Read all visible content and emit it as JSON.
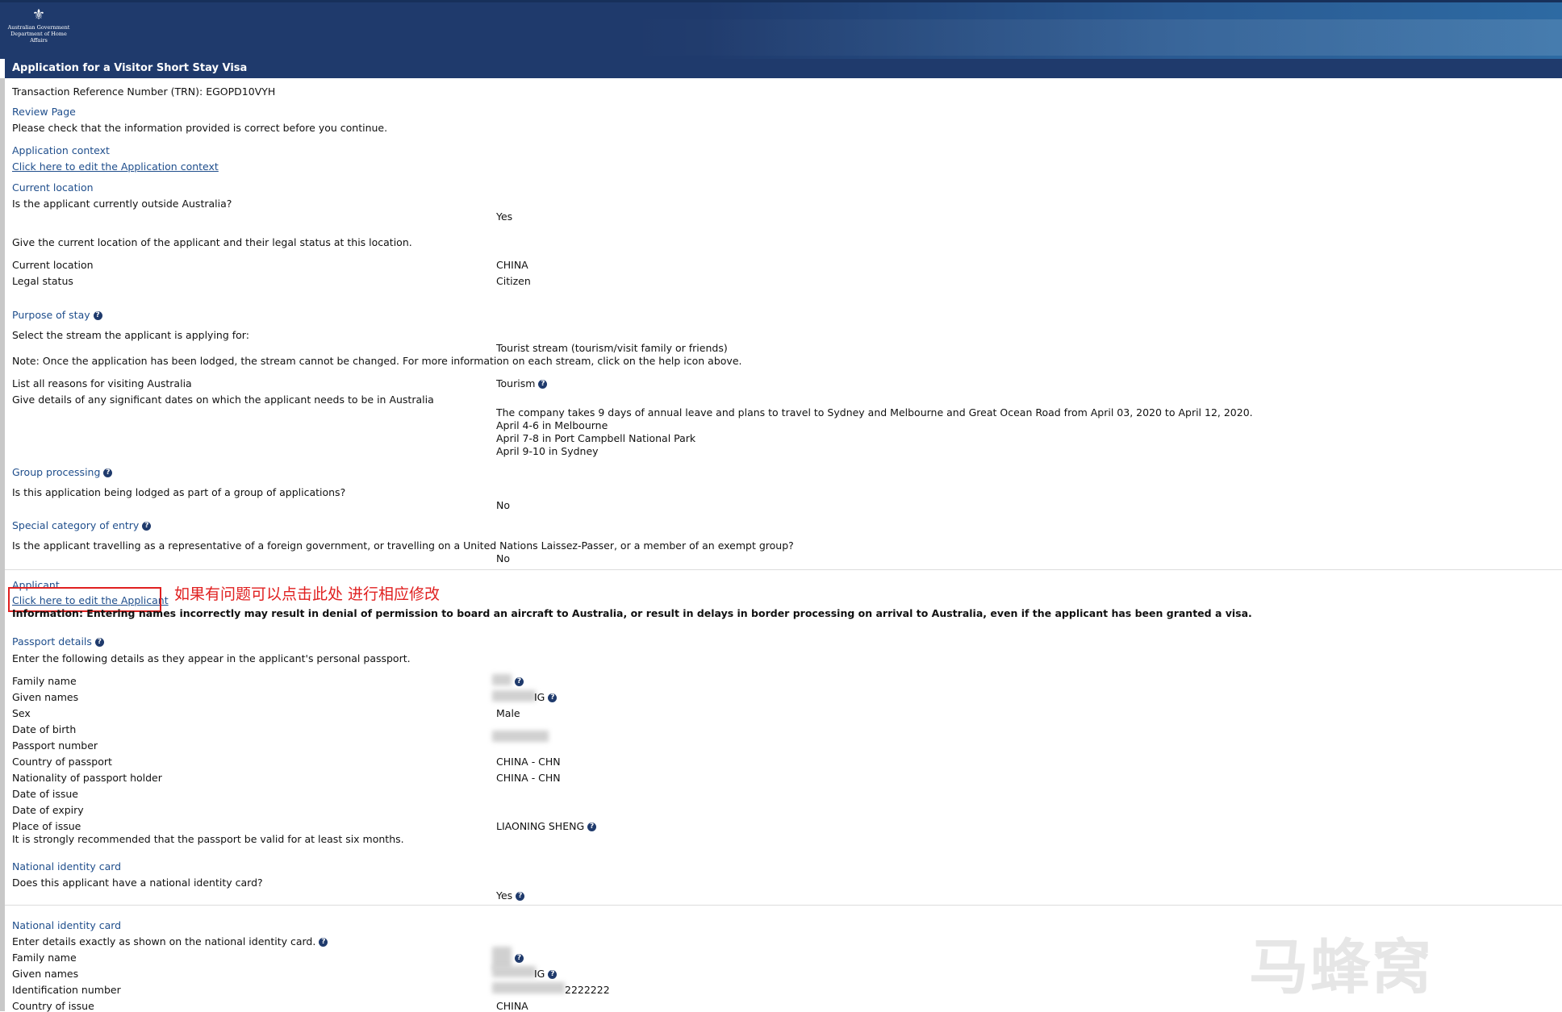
{
  "header": {
    "gov_line1": "Australian Government",
    "gov_line2": "Department of Home Affairs",
    "title": "Application for a Visitor Short Stay Visa"
  },
  "trn": "Transaction Reference Number (TRN): EGOPD10VYH",
  "review": {
    "title": "Review Page",
    "note": "Please check that the information provided is correct before you continue."
  },
  "app_context": {
    "title": "Application context",
    "edit_link": "Click here to edit the Application context"
  },
  "current_location": {
    "title": "Current location",
    "q_outside": "Is the applicant currently outside Australia?",
    "a_outside": "Yes",
    "give_location": "Give the current location of the applicant and their legal status at this location.",
    "location_label": "Current location",
    "location_value": "CHINA",
    "status_label": "Legal status",
    "status_value": "Citizen"
  },
  "purpose": {
    "title": "Purpose of stay",
    "q_stream": "Select the stream the applicant is applying for:",
    "a_stream": "Tourist stream (tourism/visit family or friends)",
    "note": "Note: Once the application has been lodged, the stream cannot be changed. For more information on each stream, click on the help icon above.",
    "reasons_label": "List all reasons for visiting Australia",
    "reasons_value": "Tourism",
    "dates_label": "Give details of any significant dates on which the applicant needs to be in Australia",
    "dates_lines": [
      "The company takes 9 days of annual leave and plans to travel to Sydney and Melbourne and Great Ocean Road from April 03, 2020 to April 12, 2020.",
      "April 4-6 in Melbourne",
      "April 7-8 in Port Campbell National Park",
      "April 9-10 in Sydney"
    ]
  },
  "group": {
    "title": "Group processing",
    "question": "Is this application being lodged as part of a group of applications?",
    "answer": "No"
  },
  "special": {
    "title": "Special category of entry",
    "question": "Is the applicant travelling as a representative of a foreign government, or travelling on a United Nations Laissez-Passer, or a member of an exempt group?",
    "answer": "No"
  },
  "applicant": {
    "title": "Applicant",
    "edit_link": "Click here to edit the Applicant",
    "info": "Information: Entering names incorrectly may result in denial of permission to board an aircraft to Australia, or result in delays in border processing on arrival to Australia, even if the applicant has been granted a visa."
  },
  "annotation": "如果有问题可以点击此处 进行相应修改",
  "passport": {
    "title": "Passport details",
    "intro": "Enter the following details as they appear in the applicant's personal passport.",
    "labels": {
      "family_name": "Family name",
      "given_names": "Given names",
      "sex": "Sex",
      "dob": "Date of birth",
      "number": "Passport number",
      "country": "Country of passport",
      "nationality": "Nationality of passport holder",
      "issue": "Date of issue",
      "expiry": "Date of expiry",
      "place": "Place of issue"
    },
    "values": {
      "given_names_tail": "IG",
      "sex": "Male",
      "country": "CHINA - CHN",
      "nationality": "CHINA - CHN",
      "place": "LIAONING SHENG"
    },
    "validity_note": "It is strongly recommended that the passport be valid for at least six months."
  },
  "nic1": {
    "title": "National identity card",
    "question": "Does this applicant have a national identity card?",
    "answer": "Yes"
  },
  "nic2": {
    "title": "National identity card",
    "intro": "Enter details exactly as shown on the national identity card.",
    "family_label": "Family name",
    "given_label": "Given names",
    "given_tail": "IG",
    "id_label": "Identification number",
    "id_tail": "2222222",
    "country_label": "Country of issue",
    "country_value": "CHINA"
  },
  "watermark": "马蜂窝"
}
